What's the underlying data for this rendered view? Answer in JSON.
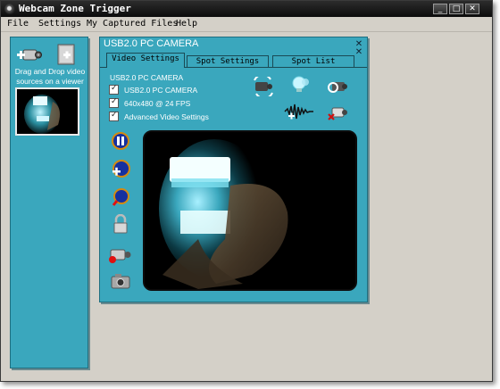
{
  "window": {
    "title": "Webcam Zone Trigger",
    "controls": [
      "_",
      "□",
      "✕"
    ]
  },
  "menu": [
    "File",
    "Settings",
    "My Captured Files",
    "Help"
  ],
  "sources": {
    "hint": "Drag and Drop video sources on a viewer"
  },
  "viewer": {
    "title": "USB2.0 PC CAMERA",
    "tabs": [
      "Video Settings",
      "Spot Settings",
      "Spot List"
    ],
    "active_tab": "Video Settings",
    "device_name": "USB2.0 PC CAMERA",
    "options": [
      {
        "label": "USB2.0 PC CAMERA",
        "checked": true
      },
      {
        "label": "640x480 @ 24 FPS",
        "checked": true
      },
      {
        "label": "Advanced Video Settings",
        "checked": true
      }
    ],
    "toolbar_icons": [
      "rotate-camera-icon",
      "bulb-hint-icon",
      "camera-settings-icon",
      "audio-wave-icon",
      "remove-camera-icon"
    ],
    "side_icons": [
      "pause-icon",
      "add-zone-icon",
      "zoom-icon",
      "lock-icon",
      "record-camera-icon",
      "snapshot-icon"
    ]
  },
  "colors": {
    "panel": "#3aa7bd",
    "window_bg": "#d4d0c8",
    "titlebar": "#111111"
  }
}
